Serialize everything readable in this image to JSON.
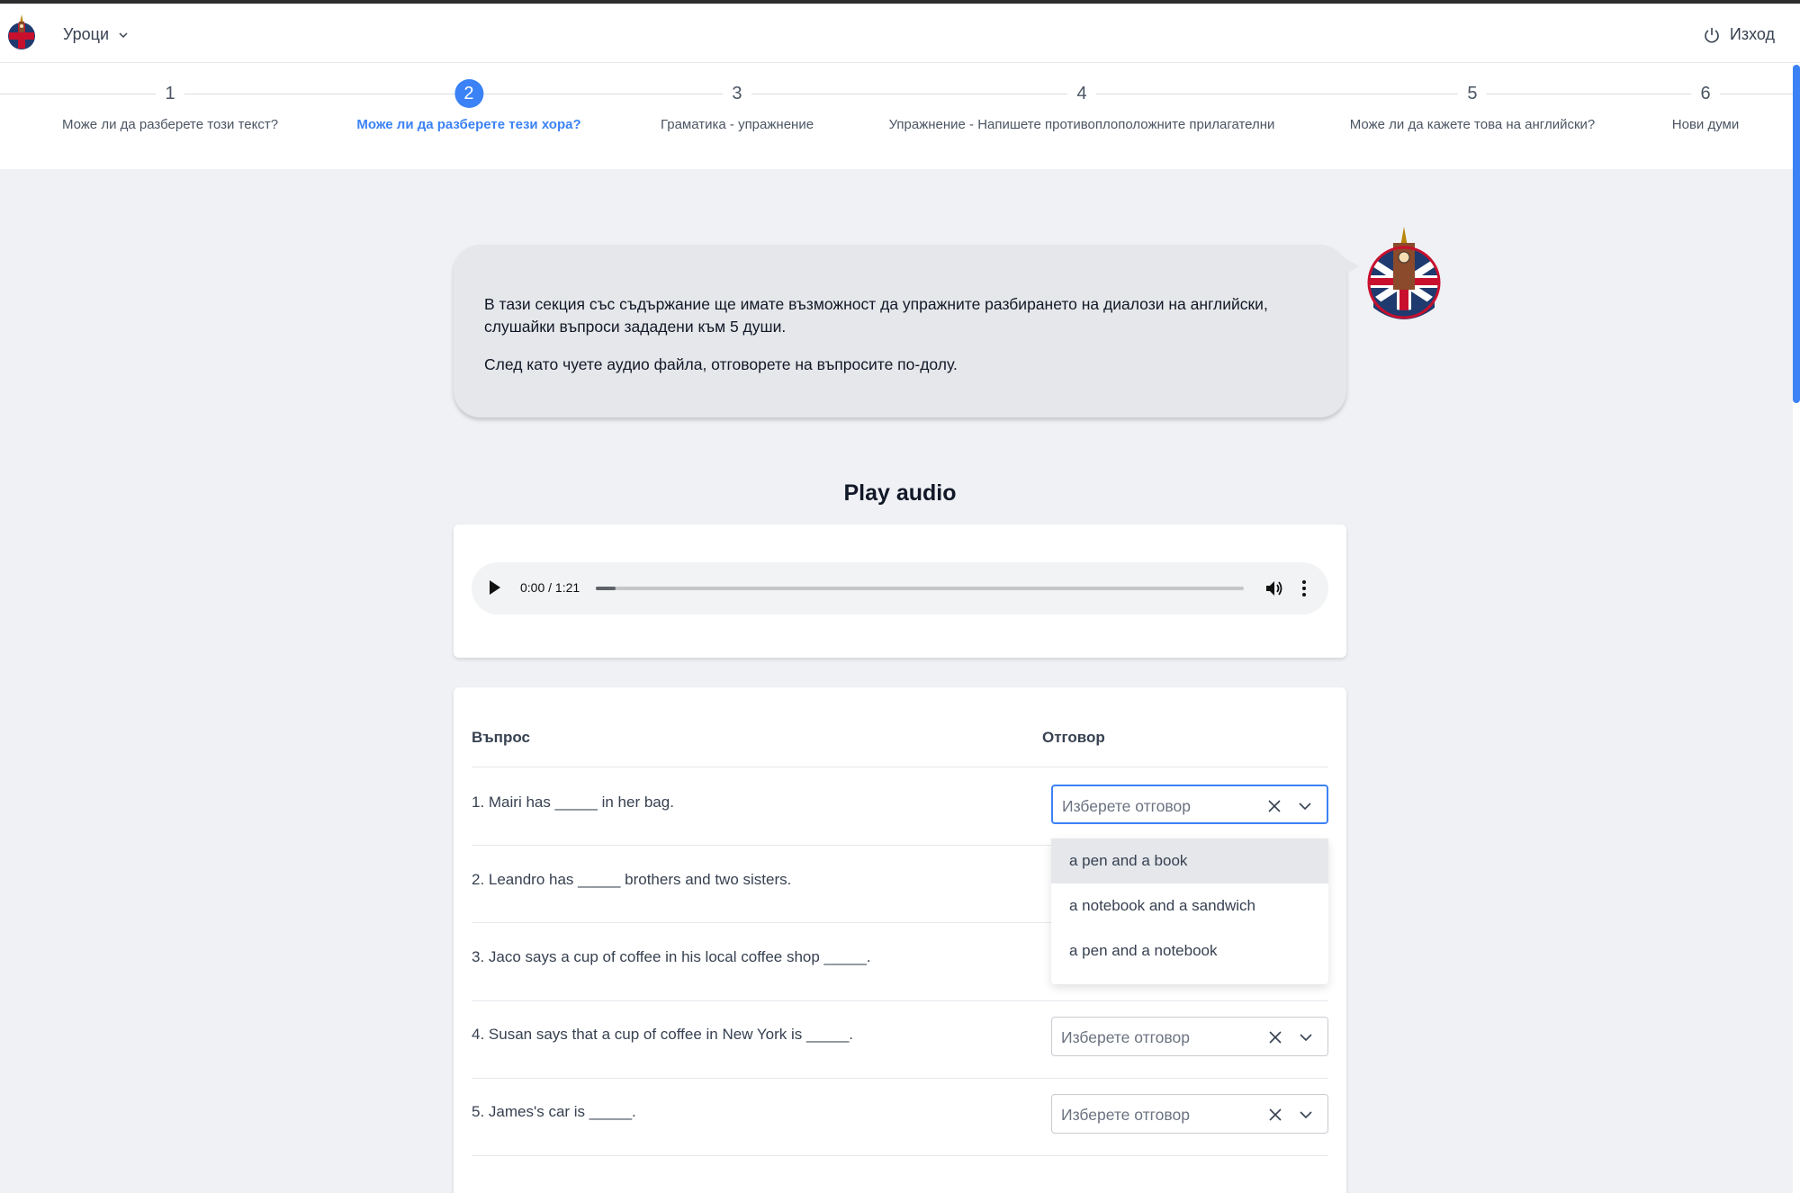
{
  "header": {
    "menu_label": "Уроци",
    "logout_label": "Изход"
  },
  "steps": [
    {
      "num": "1",
      "label": "Може ли да разберете този текст?"
    },
    {
      "num": "2",
      "label": "Може ли да разберете тези хора?"
    },
    {
      "num": "3",
      "label": "Граматика - упражнение"
    },
    {
      "num": "4",
      "label": "Упражнение - Напишете противоплоположните прилагателни"
    },
    {
      "num": "5",
      "label": "Може ли да кажете това на английски?"
    },
    {
      "num": "6",
      "label": "Нови думи"
    }
  ],
  "active_step": 2,
  "intro": {
    "paragraph1": "В тази секция със съдържание ще имате възможност да упражните разбирането на диалози на английски, слушайки въпроси зададени към 5 души.",
    "paragraph2": "След като чуете аудио файла, отговорете на въпросите по-долу."
  },
  "audio": {
    "title": "Play audio",
    "time": "0:00 / 1:21",
    "progress_fraction": 0.03
  },
  "table": {
    "col_question": "Въпрос",
    "col_answer": "Отговор",
    "select_placeholder": "Изберете отговор",
    "questions": [
      "1. Mairi has _____ in her bag.",
      "2. Leandro has _____ brothers and two sisters.",
      "3. Jaco says a cup of coffee in his local coffee shop _____.",
      "4. Susan says that a cup of coffee in New York is _____.",
      "5. James's car is _____."
    ]
  },
  "dropdown_options": [
    "a pen and a book",
    "a notebook and a sandwich",
    "a pen and a notebook"
  ],
  "colors": {
    "accent": "#3b82f6",
    "page_bg": "#eff1f5",
    "bubble_bg": "#e6e7ea"
  }
}
